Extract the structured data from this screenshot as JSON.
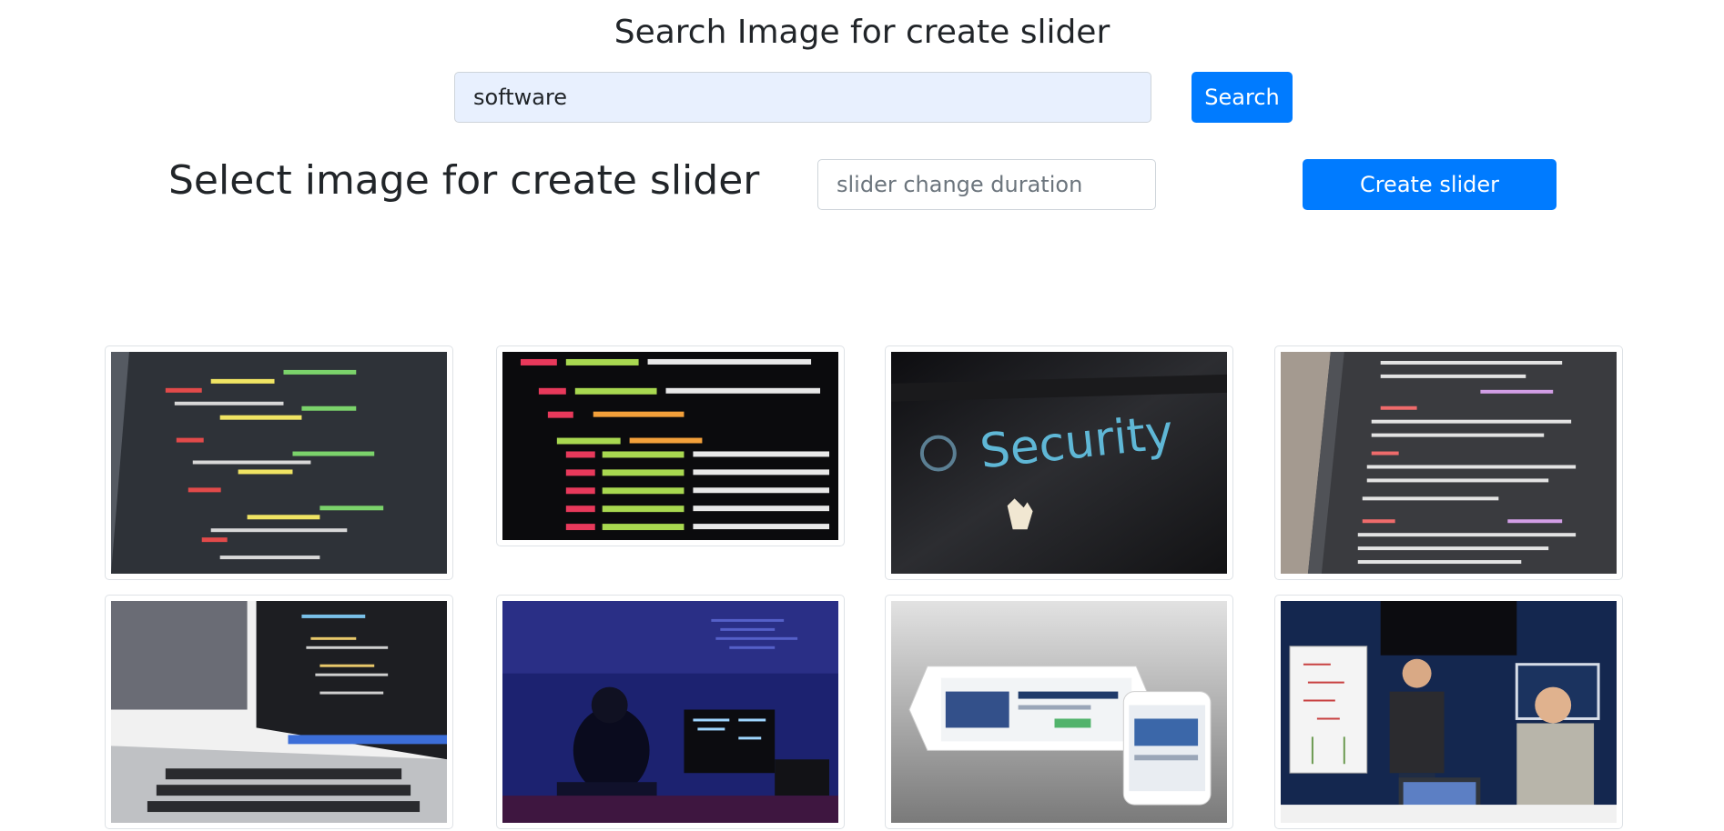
{
  "header": {
    "title": "Search Image for create slider"
  },
  "search": {
    "value": "software",
    "button_label": "Search"
  },
  "slider_form": {
    "title": "Select image for create slider",
    "duration_placeholder": "slider change duration",
    "create_label": "Create slider"
  },
  "images": {
    "img1": {
      "alt": "code on monitor"
    },
    "img2": {
      "alt": "html code close-up"
    },
    "img3": {
      "alt": "Security"
    },
    "img4": {
      "alt": "javascript code on screen"
    },
    "img5": {
      "alt": "laptop with code editor"
    },
    "img6": {
      "alt": "developer at dark desk"
    },
    "img7": {
      "alt": "tablet and phone"
    },
    "img8": {
      "alt": "whiteboard presentation"
    }
  },
  "colors": {
    "accent": "#007bff",
    "input_autofill": "#e8f0fe"
  }
}
